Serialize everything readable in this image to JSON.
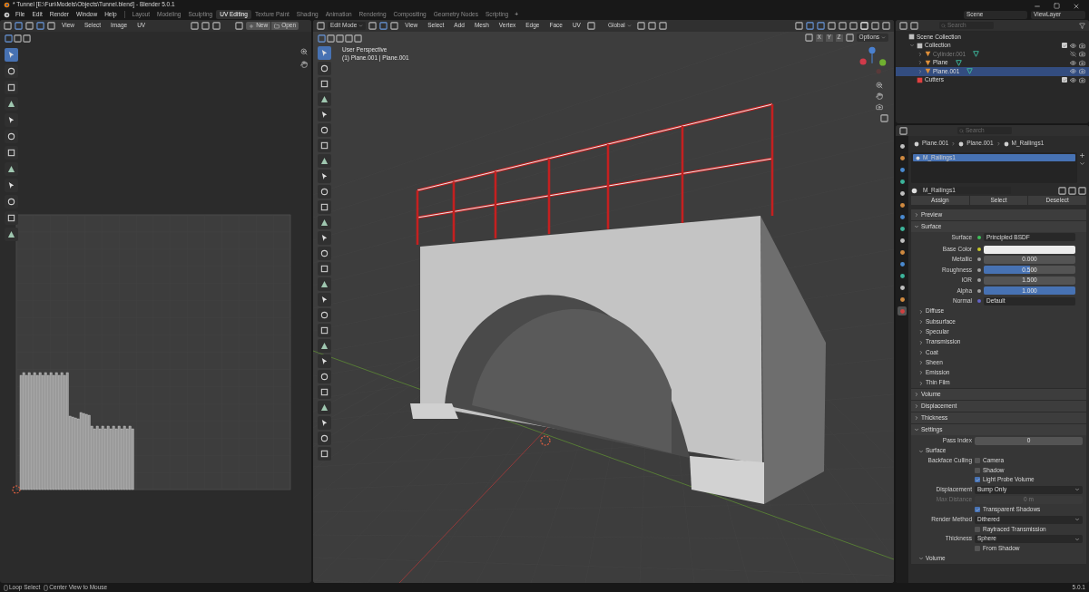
{
  "window": {
    "title": "* Tunnel [E:\\Fun\\Models\\Objects\\Tunnel.blend] - Blender 5.0.1"
  },
  "menu": [
    "File",
    "Edit",
    "Render",
    "Window",
    "Help"
  ],
  "workspaces": [
    {
      "label": "Layout",
      "selected": false
    },
    {
      "label": "Modeling",
      "selected": false
    },
    {
      "label": "Sculpting",
      "selected": false
    },
    {
      "label": "UV Editing",
      "selected": true
    },
    {
      "label": "Texture Paint",
      "selected": false
    },
    {
      "label": "Shading",
      "selected": false
    },
    {
      "label": "Animation",
      "selected": false
    },
    {
      "label": "Rendering",
      "selected": false
    },
    {
      "label": "Compositing",
      "selected": false
    },
    {
      "label": "Geometry Nodes",
      "selected": false
    },
    {
      "label": "Scripting",
      "selected": false
    }
  ],
  "add_workspace": "+",
  "scene": "Scene",
  "view_layer": "ViewLayer",
  "uv_editor": {
    "menus": [
      "View",
      "Select",
      "Image",
      "UV"
    ],
    "new_button": "New",
    "open_button": "Open",
    "tools": [
      {
        "selected": true
      },
      {
        "selected": false
      },
      {
        "selected": false
      },
      {
        "selected": false
      },
      {
        "selected": false
      },
      {
        "selected": false
      },
      {
        "selected": false
      },
      {
        "selected": false
      },
      {
        "selected": false
      },
      {
        "selected": false
      },
      {
        "selected": false
      },
      {
        "selected": false
      }
    ]
  },
  "viewport": {
    "mode": "Edit Mode",
    "menus": [
      "View",
      "Select",
      "Add",
      "Mesh",
      "Vertex",
      "Edge",
      "Face",
      "UV"
    ],
    "orientation": "Global",
    "axes": [
      "X",
      "Y",
      "Z"
    ],
    "options": "Options",
    "view_name": "User Perspective",
    "object_info": "(1) Plane.001 | Plane.001",
    "tools": [
      {
        "selected": true
      },
      {
        "selected": false
      },
      {
        "selected": false
      },
      {
        "selected": false
      },
      {
        "selected": false
      },
      {
        "selected": false
      },
      {
        "selected": false
      },
      {
        "selected": false
      },
      {
        "selected": false
      },
      {
        "selected": false
      },
      {
        "selected": false
      },
      {
        "selected": false
      },
      {
        "selected": false
      },
      {
        "selected": false
      },
      {
        "selected": false
      },
      {
        "selected": false
      },
      {
        "selected": false
      },
      {
        "selected": false
      },
      {
        "selected": false
      },
      {
        "selected": false
      },
      {
        "selected": false
      },
      {
        "selected": false
      },
      {
        "selected": false
      },
      {
        "selected": false
      },
      {
        "selected": false
      },
      {
        "selected": false
      },
      {
        "selected": false
      }
    ]
  },
  "outliner": {
    "search_placeholder": "Search",
    "items": [
      {
        "name": "Scene Collection",
        "kind": "scene",
        "children": [
          {
            "name": "Collection",
            "kind": "collection",
            "included": true,
            "children": [
              {
                "name": "Cylinder.001",
                "kind": "object",
                "selected": false,
                "hidden": true
              },
              {
                "name": "Plane",
                "kind": "object",
                "selected": false,
                "hidden": false
              },
              {
                "name": "Plane.001",
                "kind": "object",
                "selected": true,
                "hidden": false
              }
            ]
          },
          {
            "name": "Cutters",
            "kind": "cutters",
            "included": true
          }
        ]
      }
    ]
  },
  "properties": {
    "search_placeholder": "Search",
    "tabs": [
      {
        "selected": false
      },
      {
        "selected": false
      },
      {
        "selected": false
      },
      {
        "selected": false
      },
      {
        "selected": false
      },
      {
        "selected": false
      },
      {
        "selected": false
      },
      {
        "selected": false
      },
      {
        "selected": false
      },
      {
        "selected": false
      },
      {
        "selected": false
      },
      {
        "selected": false
      },
      {
        "selected": false
      },
      {
        "selected": false
      },
      {
        "selected": true
      }
    ],
    "breadcrumb": [
      "Plane.001",
      "Plane.001",
      "M_Railings1"
    ],
    "slots": [
      {
        "name": "M_Railings1",
        "selected": true
      }
    ],
    "material_name": "M_Railings1",
    "slot_buttons": [
      "Assign",
      "Select",
      "Deselect"
    ],
    "rows": [
      {
        "kind": "panel",
        "label": "Preview",
        "expanded": false
      },
      {
        "kind": "panel",
        "label": "Surface",
        "expanded": true
      },
      {
        "kind": "field",
        "label": "Surface",
        "value": "Principled BSDF",
        "color": "#3fbf5a"
      },
      {
        "kind": "swatch",
        "label": "Base Color",
        "color": "#c7c729"
      },
      {
        "kind": "number",
        "label": "Metallic",
        "value": "0.000",
        "disabled": false,
        "color": "#a1a1a1"
      },
      {
        "kind": "slider",
        "label": "Roughness",
        "value": "0.500",
        "level": 0.5,
        "color": "#a1a1a1"
      },
      {
        "kind": "number",
        "label": "IOR",
        "value": "1.500",
        "disabled": false,
        "color": "#a1a1a1"
      },
      {
        "kind": "slider",
        "label": "Alpha",
        "value": "1.000",
        "level": 1,
        "color": "#a1a1a1"
      },
      {
        "kind": "field",
        "label": "Normal",
        "value": "Default",
        "color": "#6363c7"
      },
      {
        "kind": "subpanel",
        "label": "Diffuse",
        "expanded": false
      },
      {
        "kind": "subpanel",
        "label": "Subsurface",
        "expanded": false
      },
      {
        "kind": "subpanel",
        "label": "Specular",
        "expanded": false
      },
      {
        "kind": "subpanel",
        "label": "Transmission",
        "expanded": false
      },
      {
        "kind": "subpanel",
        "label": "Coat",
        "expanded": false
      },
      {
        "kind": "subpanel",
        "label": "Sheen",
        "expanded": false
      },
      {
        "kind": "subpanel",
        "label": "Emission",
        "expanded": false
      },
      {
        "kind": "subpanel",
        "label": "Thin Film",
        "expanded": false
      },
      {
        "kind": "panel",
        "label": "Volume",
        "expanded": false
      },
      {
        "kind": "panel",
        "label": "Displacement",
        "expanded": false
      },
      {
        "kind": "panel",
        "label": "Thickness",
        "expanded": false
      },
      {
        "kind": "panel",
        "label": "Settings",
        "expanded": true
      },
      {
        "kind": "number",
        "label": "Pass Index",
        "value": "0",
        "disabled": false
      },
      {
        "kind": "subpanel",
        "label": "Surface",
        "expanded": true
      },
      {
        "kind": "checkbox",
        "label": "Backface Culling",
        "text": "Camera",
        "checked": false
      },
      {
        "kind": "checkbox",
        "text": "Shadow",
        "checked": false
      },
      {
        "kind": "checkbox",
        "text": "Light Probe Volume",
        "checked": true
      },
      {
        "kind": "dropdown",
        "label": "Displacement",
        "value": "Bump Only"
      },
      {
        "kind": "number",
        "label": "Max Distance",
        "value": "0 m",
        "disabled": true
      },
      {
        "kind": "checkbox",
        "text": "Transparent Shadows",
        "checked": true
      },
      {
        "kind": "dropdown",
        "label": "Render Method",
        "value": "Dithered"
      },
      {
        "kind": "checkbox",
        "text": "Raytraced Transmission",
        "checked": false
      },
      {
        "kind": "dropdown",
        "label": "Thickness",
        "value": "Sphere"
      },
      {
        "kind": "checkbox",
        "text": "From Shadow",
        "checked": false
      },
      {
        "kind": "subpanel",
        "label": "Volume",
        "expanded": true
      }
    ]
  },
  "status_bar": {
    "hints": [
      "Loop Select",
      "Center View to Mouse"
    ],
    "version": "5.0.1"
  }
}
